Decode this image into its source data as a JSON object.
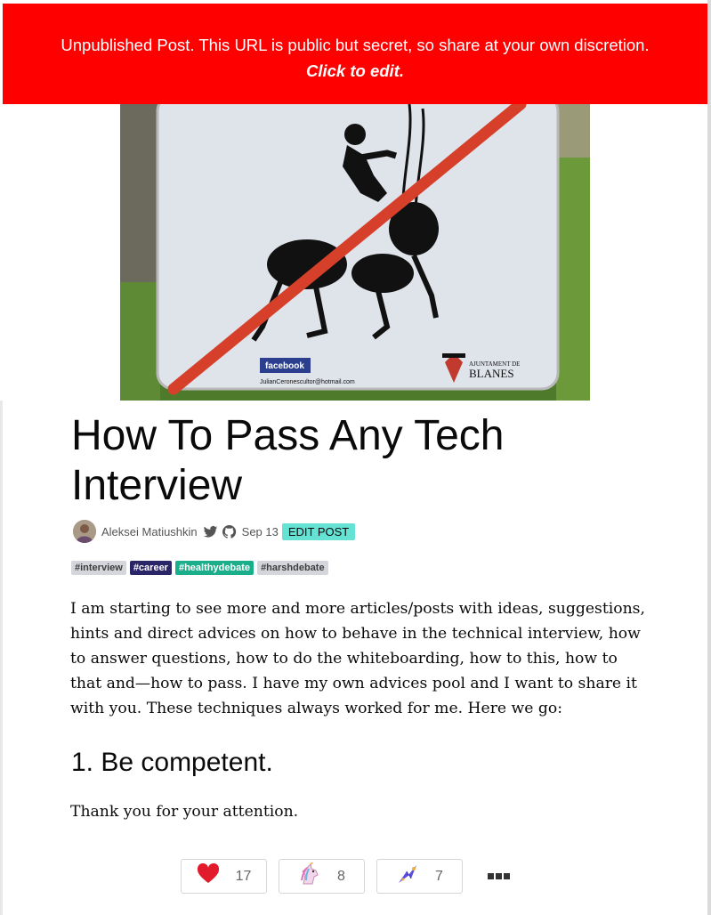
{
  "banner": {
    "message": "Unpublished Post. This URL is public but secret, so share at your own discretion.",
    "cta": "Click to edit."
  },
  "cover": {
    "brand_label": "facebook",
    "email": "JulianCeronescultor@hotmail.com",
    "city_top": "AJUNTAMENT DE",
    "city_name": "BLANES"
  },
  "article": {
    "title": "How To Pass Any Tech Interview",
    "author": "Aleksei Matiushkin",
    "date": "Sep 13",
    "edit_label": "EDIT POST",
    "tags": [
      {
        "label": "#interview",
        "bg": "#d4d6dc",
        "fg": "#3d3d3d"
      },
      {
        "label": "#career",
        "bg": "#2a2566",
        "fg": "#ffffff"
      },
      {
        "label": "#healthydebate",
        "bg": "#1aae8a",
        "fg": "#ffffff"
      },
      {
        "label": "#harshdebate",
        "bg": "#d4d6dc",
        "fg": "#3d3d3d"
      }
    ],
    "paragraph": "I am starting to see more and more articles/posts with ideas, suggestions, hints and direct advices on how to behave in the technical interview, how to answer questions, how to do the whiteboarding, how to this, how to that and—how to pass. I have my own advices pool and I want to share it with you. These techniques always worked for me. Here we go:",
    "heading": "1. Be competent.",
    "closing": "Thank you for your attention."
  },
  "reactions": {
    "heart_count": "17",
    "unicorn_count": "8",
    "bookmark_count": "7"
  },
  "colors": {
    "banner_bg": "#ff0000",
    "edit_btn_bg": "#66e2d5"
  }
}
